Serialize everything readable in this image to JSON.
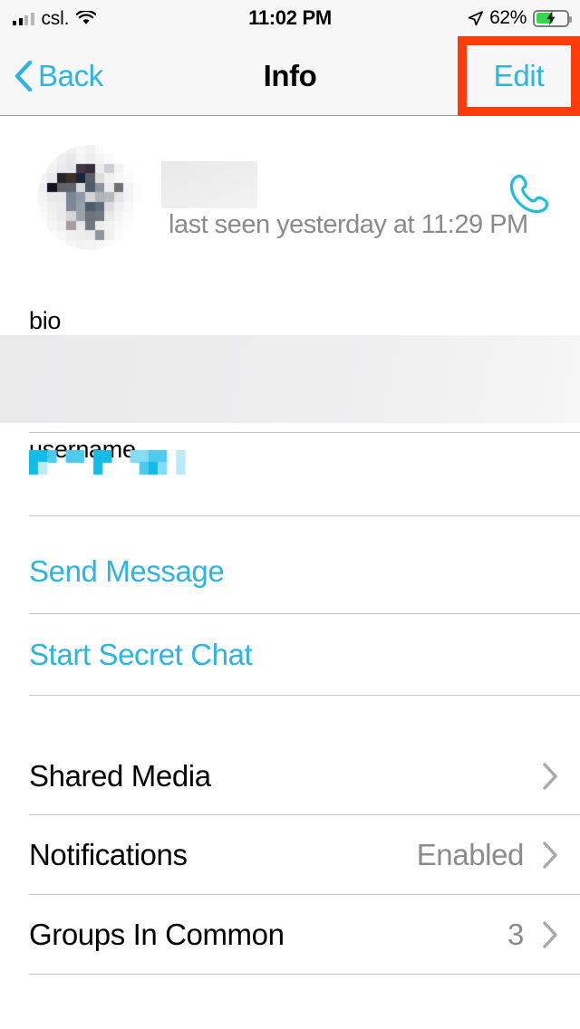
{
  "status_bar": {
    "carrier": "csl.",
    "signal_icon": "cellular-bars-icon",
    "wifi_icon": "wifi-icon",
    "time": "11:02 PM",
    "location_icon": "location-arrow-icon",
    "battery_percent": "62%",
    "battery_icon": "battery-charging-icon",
    "battery_level": 62
  },
  "nav_bar": {
    "back_label": "Back",
    "back_icon": "chevron-left-icon",
    "title": "Info",
    "edit_label": "Edit",
    "highlight_color": "#FA3C0A"
  },
  "profile": {
    "avatar": "redacted-pixelated-avatar",
    "name": "",
    "name_redacted": true,
    "status": "last seen yesterday at 11:29 PM",
    "call_icon": "phone-call-icon"
  },
  "fields": {
    "bio_label": "bio",
    "bio_value": "",
    "bio_redacted": true,
    "username_label": "username",
    "username_value": "",
    "username_redacted": true
  },
  "actions": [
    {
      "label": "Send Message",
      "name": "send-message"
    },
    {
      "label": "Start Secret Chat",
      "name": "start-secret-chat"
    }
  ],
  "menu_rows": [
    {
      "label": "Shared Media",
      "value": "",
      "name": "shared-media"
    },
    {
      "label": "Notifications",
      "value": "Enabled",
      "name": "notifications"
    },
    {
      "label": "Groups In Common",
      "value": "3",
      "name": "groups-in-common"
    }
  ],
  "colors": {
    "accent": "#2BB5DF",
    "secondary_text": "#8b8b8e",
    "separator": "#c4c4c6",
    "bar_background": "#F7F7F7",
    "highlight": "#FA3C0A",
    "battery_green": "#32D74B"
  }
}
